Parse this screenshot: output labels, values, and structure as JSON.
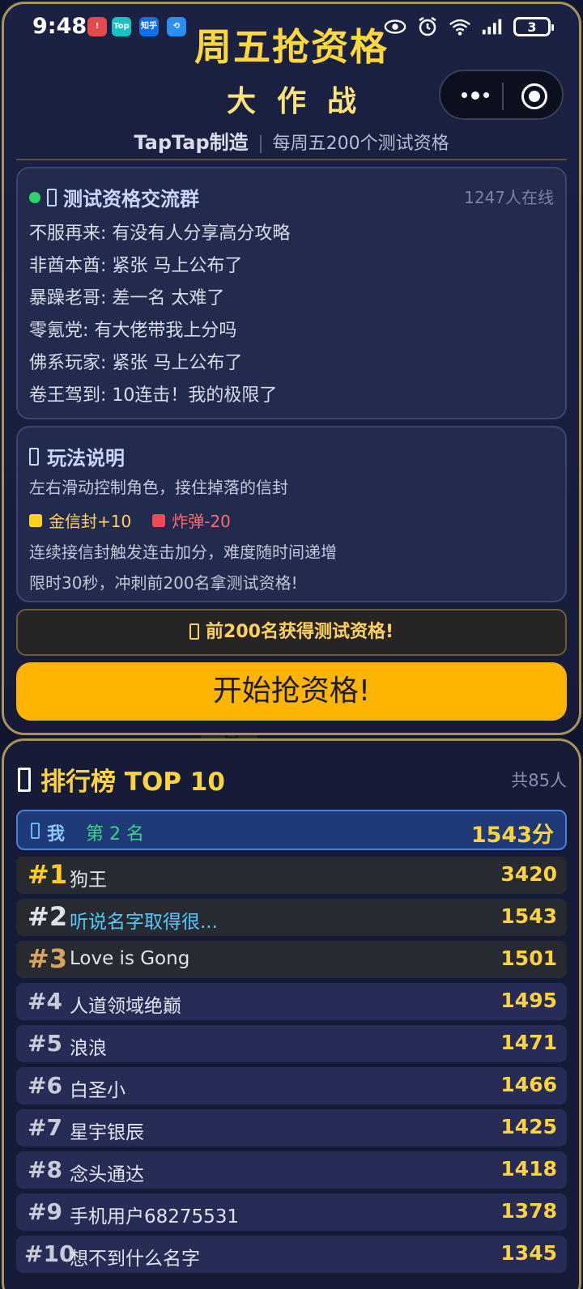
{
  "status_bar": {
    "time": "9:48",
    "apps": [
      {
        "label": "!",
        "color": "#e5484d"
      },
      {
        "label": "Top",
        "color": "#19c2c2"
      },
      {
        "label": "知乎",
        "color": "#0f6fe6"
      },
      {
        "label": "⟲",
        "color": "#2e8df0"
      }
    ],
    "battery": "3"
  },
  "header": {
    "title_line1": "周五抢资格",
    "title_line2": "大作战",
    "brand": "TapTap制造",
    "tagline": "每周五200个测试资格"
  },
  "chat": {
    "title": "测试资格交流群",
    "online": "1247人在线",
    "messages": [
      "不服再来: 有没有人分享高分攻略",
      "非酋本酋: 紧张 马上公布了",
      "暴躁老哥: 差一名 太难了",
      "零氪党: 有大佬带我上分吗",
      "佛系玩家: 紧张 马上公布了",
      "卷王驾到: 10连击！我的极限了"
    ]
  },
  "rules": {
    "title": "玩法说明",
    "line1": "左右滑动控制角色，接住掉落的信封",
    "gold": "金信封+10",
    "bomb": "炸弹-20",
    "line2": "连续接信封触发连击加分，难度随时间递增",
    "line3": "限时30秒，冲刺前200名拿测试资格!"
  },
  "reward": "前200名获得测试资格!",
  "start_button": "开始抢资格!",
  "leaderboard": {
    "title": "排行榜 TOP 10",
    "total": "共85人",
    "me": {
      "label": "我",
      "rank": "第 2 名",
      "score": "1543分"
    },
    "rows": [
      {
        "rank": "#1",
        "name": "狗王",
        "score": "3420"
      },
      {
        "rank": "#2",
        "name": "听说名字取得很...",
        "score": "1543"
      },
      {
        "rank": "#3",
        "name": "Love is Gong",
        "score": "1501"
      },
      {
        "rank": "#4",
        "name": "人道领域绝巅",
        "score": "1495"
      },
      {
        "rank": "#5",
        "name": "浪浪",
        "score": "1471"
      },
      {
        "rank": "#6",
        "name": "白圣小",
        "score": "1466"
      },
      {
        "rank": "#7",
        "name": "星宇银辰",
        "score": "1425"
      },
      {
        "rank": "#8",
        "name": "念头通达",
        "score": "1418"
      },
      {
        "rank": "#9",
        "name": "手机用户68275531",
        "score": "1378"
      },
      {
        "rank": "#10",
        "name": "想不到什么名字",
        "score": "1345"
      }
    ]
  }
}
